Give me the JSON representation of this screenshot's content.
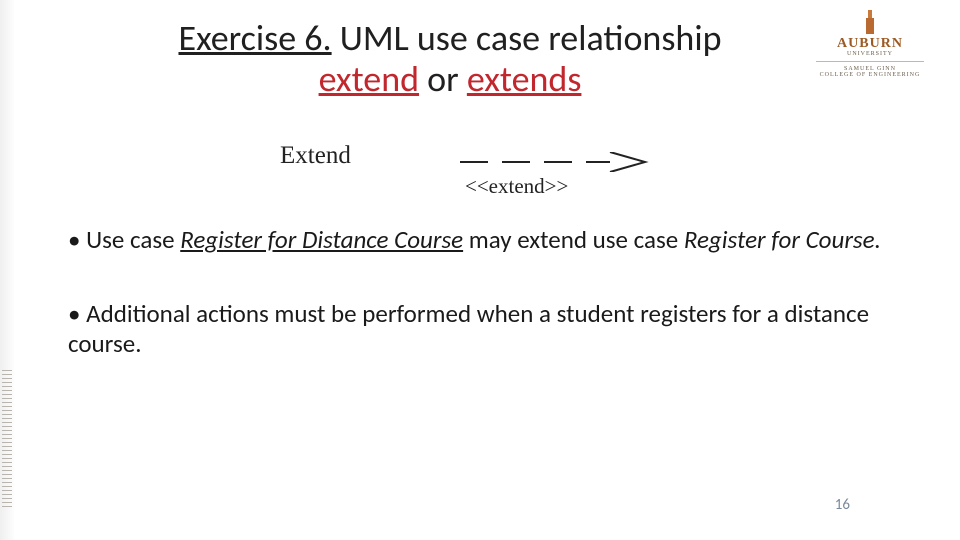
{
  "title": {
    "prefix": "Exercise 6.",
    "rest1": " UML use case relationship",
    "red1": "extend",
    "or": " or ",
    "red2": "extends"
  },
  "logo": {
    "name": "AUBURN",
    "subname": "UNIVERSITY",
    "line1": "SAMUEL GINN",
    "line2": "COLLEGE OF ENGINEERING"
  },
  "diagram": {
    "label": "Extend",
    "stereotype": "<<extend>>"
  },
  "bullets": {
    "b1": {
      "lead": "• Use case ",
      "iu1": "Register for Distance Course",
      "mid": " may extend use case ",
      "i1": "Register for Course.",
      "tail": ""
    },
    "b2": {
      "text": "• Additional actions must be performed when a student registers for a distance course."
    }
  },
  "page_number": "16"
}
